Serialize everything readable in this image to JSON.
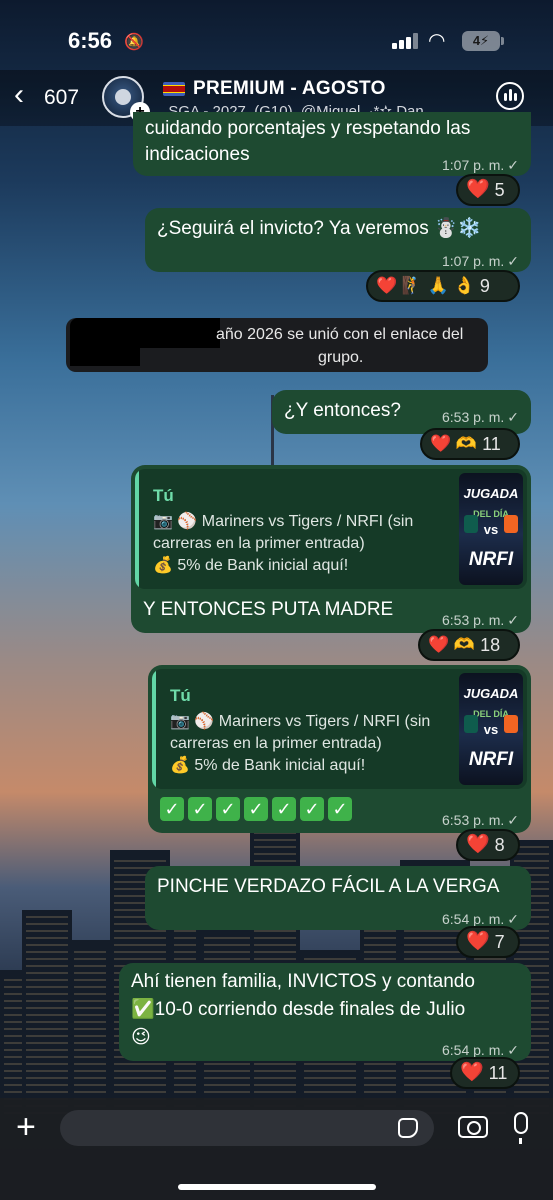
{
  "status": {
    "time": "6:56",
    "battery": "4"
  },
  "header": {
    "back_count": "607",
    "title": "PREMIUM - AGOSTO",
    "subtitle": ". SGA - 2027, (G10), @Miguel, ·*✫ Dan..."
  },
  "messages": [
    {
      "line1": "cuidando porcentajes y respetando las",
      "line2": "indicaciones",
      "time": "1:07 p. m.",
      "reaction": {
        "emojis": "❤️",
        "count": "5"
      }
    },
    {
      "text": "¿Seguirá el invicto? Ya veremos ☃️❄️",
      "time": "1:07 p. m.",
      "reaction": {
        "emojis": "❤️ 🧗 🙏 👌",
        "count": "9"
      }
    },
    {
      "system_line1": "año 2026 se unió con el enlace del",
      "system_line2": "grupo."
    },
    {
      "text": "¿Y entonces?",
      "time": "6:53 p. m.",
      "reaction": {
        "emojis": "❤️ 🫶",
        "count": "11"
      }
    },
    {
      "quote_author": "Tú",
      "quote_line1": "📷 ⚾ Mariners vs Tigers / NRFI (sin",
      "quote_line2": "carreras en la primer entrada)",
      "quote_line3": "💰 5% de Bank inicial aquí!",
      "text": "Y ENTONCES PUTA MADRE",
      "time": "6:53 p. m.",
      "reaction": {
        "emojis": "❤️ 🫶",
        "count": "18"
      }
    },
    {
      "quote_author": "Tú",
      "quote_line1": "📷 ⚾ Mariners vs Tigers / NRFI (sin",
      "quote_line2": "carreras en la primer entrada)",
      "quote_line3": "💰 5% de Bank inicial aquí!",
      "checks": [
        "✓",
        "✓",
        "✓",
        "✓",
        "✓",
        "✓",
        "✓"
      ],
      "time": "6:53 p. m.",
      "reaction": {
        "emojis": "❤️",
        "count": "8"
      }
    },
    {
      "text": "PINCHE VERDAZO FÁCIL A LA VERGA",
      "time": "6:54 p. m.",
      "reaction": {
        "emojis": "❤️",
        "count": "7"
      }
    },
    {
      "line1": "Ahí tienen familia, INVICTOS y contando",
      "line2": "✅10-0 corriendo desde finales de Julio",
      "line3": "😉",
      "time": "6:54 p. m.",
      "reaction": {
        "emojis": "❤️",
        "count": "11"
      }
    }
  ],
  "thumbnail": {
    "title": "JUGADA",
    "subtitle": "DEL DÍA",
    "vs": "vs",
    "tag": "NRFI"
  },
  "composer": {
    "placeholder": ""
  },
  "colors": {
    "bubble": "#1e4a31",
    "quote_bar": "#62d6a6",
    "heart": "#ff2d45"
  }
}
